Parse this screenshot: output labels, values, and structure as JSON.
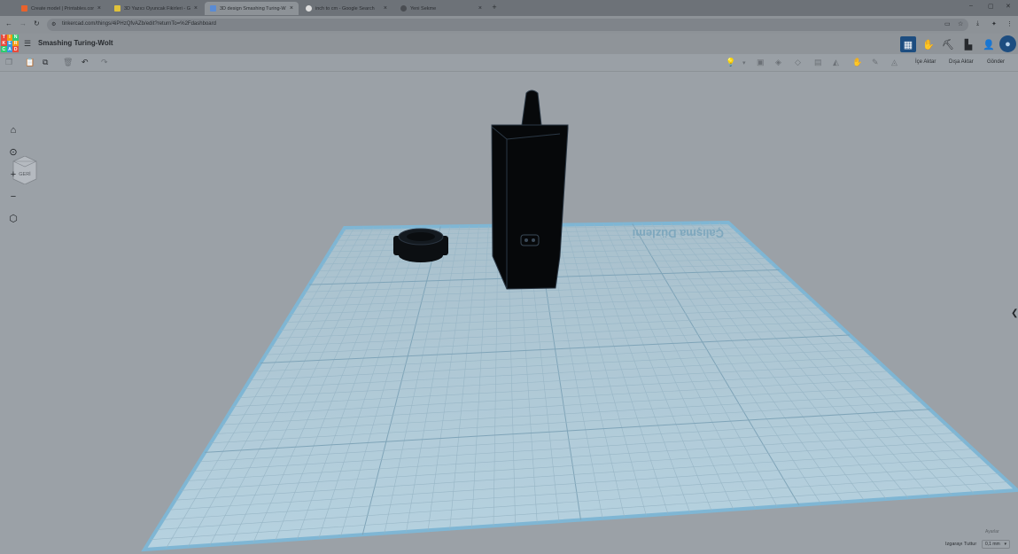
{
  "browser": {
    "tabs": [
      {
        "title": "Create model | Printables.com",
        "favicon_color": "#e8622c"
      },
      {
        "title": "3D Yazıcı Oyuncak Fikirleri - G…",
        "favicon_color": "#e0c23a"
      },
      {
        "title": "3D design Smashing Turing-W…",
        "favicon_color": "#5a8bd4"
      },
      {
        "title": "inch to cm - Google Search",
        "favicon_color": "#dedede"
      },
      {
        "title": "Yeni Sekme",
        "favicon_color": "#4a4d52"
      }
    ],
    "url": "tinkercad.com/things/4iPHzQfvAZb/edit?returnTo=%2Fdashboard"
  },
  "app": {
    "title": "Smashing Turing-Wolt",
    "logo_letters": [
      "T",
      "I",
      "N",
      "K",
      "E",
      "R",
      "C",
      "A",
      "D"
    ],
    "logo_colors": [
      "#e84b3c",
      "#f39c12",
      "#2ecc71",
      "#e84b3c",
      "#3498db",
      "#f39c12",
      "#2ecc71",
      "#3498db",
      "#e84b3c"
    ]
  },
  "toolbar": {
    "import_label": "İçe Aktar",
    "export_label": "Dışa Aktar",
    "send_label": "Gönder"
  },
  "workspace": {
    "viewcube_label": "GERİ",
    "workplane_label": "Çalışma Düzlemi",
    "settings_label": "Ayarlar",
    "snap_label": "Izgarayı Tuttur",
    "snap_value": "0,1 mm"
  }
}
